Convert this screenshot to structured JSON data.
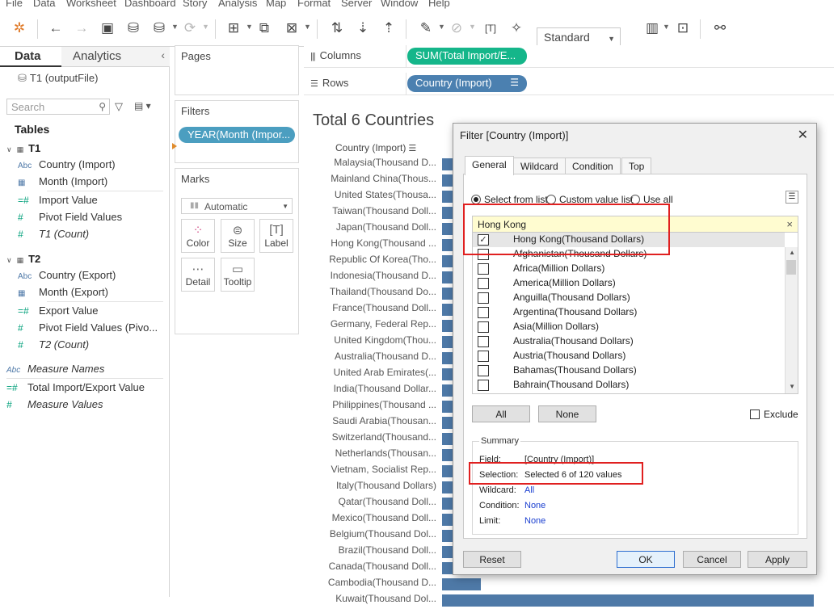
{
  "menu": [
    "File",
    "Data",
    "Worksheet",
    "Dashboard",
    "Story",
    "Analysis",
    "Map",
    "Format",
    "Server",
    "Window",
    "Help"
  ],
  "toolbar": {
    "fit_select": "Standard"
  },
  "left_pane": {
    "tab_data": "Data",
    "tab_analytics": "Analytics",
    "datasource": "T1 (outputFile)",
    "search_placeholder": "Search",
    "tables_label": "Tables",
    "t1": {
      "name": "T1",
      "fields": [
        {
          "icon": "Abc",
          "label": "Country (Import)"
        },
        {
          "icon": "▦",
          "label": "Month (Import)"
        },
        {
          "icon": "=#",
          "label": "Import Value"
        },
        {
          "icon": "#",
          "label": "Pivot Field Values"
        },
        {
          "icon": "#",
          "label": "T1 (Count)"
        }
      ]
    },
    "t2": {
      "name": "T2",
      "fields": [
        {
          "icon": "Abc",
          "label": "Country (Export)"
        },
        {
          "icon": "▦",
          "label": "Month (Export)"
        },
        {
          "icon": "=#",
          "label": "Export Value"
        },
        {
          "icon": "#",
          "label": "Pivot Field Values (Pivo..."
        },
        {
          "icon": "#",
          "label": "T2 (Count)"
        }
      ]
    },
    "extra_fields": [
      {
        "icon": "Abc",
        "label": "Measure Names"
      },
      {
        "icon": "=#",
        "label": "Total Import/Export Value"
      },
      {
        "icon": "#",
        "label": "Measure Values"
      }
    ]
  },
  "cards": {
    "pages": "Pages",
    "filters": "Filters",
    "filter_pill": "YEAR(Month (Impor...",
    "marks": "Marks",
    "marks_type": "Automatic",
    "mark_buttons": [
      "Color",
      "Size",
      "Label",
      "Detail",
      "Tooltip"
    ]
  },
  "shelves": {
    "columns_label": "Columns",
    "columns_pill": "SUM(Total Import/E...",
    "rows_label": "Rows",
    "rows_pill": "Country (Import)"
  },
  "view": {
    "title": "Total 6 Countries",
    "row_header": "Country (Import)",
    "rows": [
      {
        "label": "Malaysia(Thousand D..."
      },
      {
        "label": "Mainland China(Thous..."
      },
      {
        "label": "United States(Thousa..."
      },
      {
        "label": "Taiwan(Thousand Doll..."
      },
      {
        "label": "Japan(Thousand Doll..."
      },
      {
        "label": "Hong Kong(Thousand ..."
      },
      {
        "label": "Republic Of Korea(Tho..."
      },
      {
        "label": "Indonesia(Thousand D..."
      },
      {
        "label": "Thailand(Thousand Do..."
      },
      {
        "label": "France(Thousand Doll..."
      },
      {
        "label": "Germany, Federal Rep..."
      },
      {
        "label": "United Kingdom(Thou..."
      },
      {
        "label": "Australia(Thousand D..."
      },
      {
        "label": "United Arab Emirates(..."
      },
      {
        "label": "India(Thousand Dollar..."
      },
      {
        "label": "Philippines(Thousand ..."
      },
      {
        "label": "Saudi Arabia(Thousan..."
      },
      {
        "label": "Switzerland(Thousand..."
      },
      {
        "label": "Netherlands(Thousan..."
      },
      {
        "label": "Vietnam, Socialist Rep..."
      },
      {
        "label": "Italy(Thousand Dollars)"
      },
      {
        "label": "Qatar(Thousand Doll..."
      },
      {
        "label": "Mexico(Thousand Doll..."
      },
      {
        "label": "Belgium(Thousand Dol..."
      },
      {
        "label": "Brazil(Thousand Doll..."
      },
      {
        "label": "Canada(Thousand Doll..."
      },
      {
        "label": "Cambodia(Thousand D..."
      },
      {
        "label": "Kuwait(Thousand Dol..."
      }
    ]
  },
  "dialog": {
    "title": "Filter [Country (Import)]",
    "tabs": [
      "General",
      "Wildcard",
      "Condition",
      "Top"
    ],
    "radio_select": "Select from list",
    "radio_custom": "Custom value list",
    "radio_all": "Use all",
    "search_value": "Hong Kong",
    "items": [
      {
        "label": "Hong Kong(Thousand Dollars)",
        "checked": true
      },
      {
        "label": "Afghanistan(Thousand Dollars)",
        "checked": false
      },
      {
        "label": "Africa(Million Dollars)",
        "checked": false
      },
      {
        "label": "America(Million Dollars)",
        "checked": false
      },
      {
        "label": "Anguilla(Thousand Dollars)",
        "checked": false
      },
      {
        "label": "Argentina(Thousand Dollars)",
        "checked": false
      },
      {
        "label": "Asia(Million Dollars)",
        "checked": false
      },
      {
        "label": "Australia(Thousand Dollars)",
        "checked": false
      },
      {
        "label": "Austria(Thousand Dollars)",
        "checked": false
      },
      {
        "label": "Bahamas(Thousand Dollars)",
        "checked": false
      },
      {
        "label": "Bahrain(Thousand Dollars)",
        "checked": false
      }
    ],
    "btn_all": "All",
    "btn_none": "None",
    "exclude": "Exclude",
    "summary_title": "Summary",
    "summary": {
      "field_k": "Field:",
      "field_v": "[Country (Import)]",
      "selection_k": "Selection:",
      "selection_v": "Selected 6 of 120 values",
      "wildcard_k": "Wildcard:",
      "wildcard_v": "All",
      "condition_k": "Condition:",
      "condition_v": "None",
      "limit_k": "Limit:",
      "limit_v": "None"
    },
    "btn_reset": "Reset",
    "btn_ok": "OK",
    "btn_cancel": "Cancel",
    "btn_apply": "Apply"
  }
}
